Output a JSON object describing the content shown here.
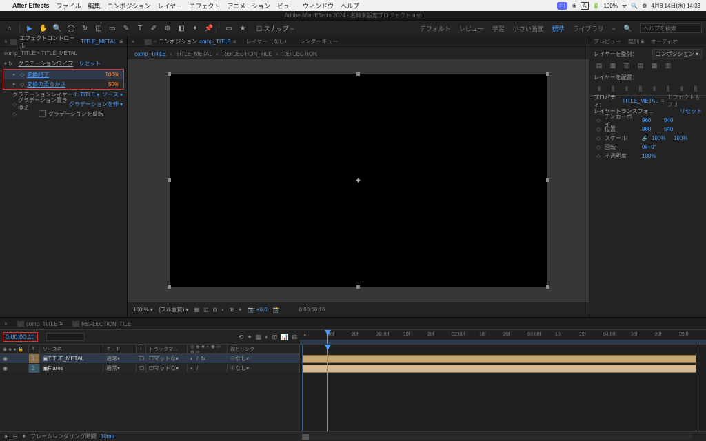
{
  "menubar": {
    "app": "After Effects",
    "items": [
      "ファイル",
      "編集",
      "コンポジション",
      "レイヤー",
      "エフェクト",
      "アニメーション",
      "ビュー",
      "ウィンドウ",
      "ヘルプ"
    ],
    "right": {
      "battery": "100%",
      "time": "4月8 14日(水) 14:33"
    }
  },
  "title": "Adobe After Effects 2024 - 名称未設定プロジェクト.aep",
  "toolbar": {
    "snap": "スナップ",
    "tabs": [
      "デフォルト",
      "レビュー",
      "学習",
      "小さい画面",
      "標準"
    ],
    "library": "ライブラリ",
    "search": "ヘルプを検索"
  },
  "effectsPanel": {
    "tab": "エフェクトコントロール",
    "layer": "TITLE_METAL",
    "compLayer": "comp_TITLE・TITLE_METAL",
    "fxName": "グラデーションワイプ",
    "reset": "リセット",
    "props": {
      "endLabel": "変換終了",
      "endVal": "100%",
      "softLabel": "変換の柔らかさ",
      "softVal": "50%",
      "gradLayer": "グラデーションレイヤー",
      "gradLayerVal": "1. TITLE ▾",
      "source": "ソース ▾",
      "placement": "グラデーション置き換え",
      "placementVal": "グラデーションを伸 ▾",
      "invert": "グラデーションを反転"
    }
  },
  "compPanel": {
    "tab": "コンポジション",
    "comp": "comp_TITLE",
    "other": [
      "レイヤー（なし）",
      "レンダーキュー"
    ],
    "breadcrumb": [
      "comp_TITLE",
      "TITLE_METAL",
      "REFLECTION_TILE",
      "REFLECTION"
    ]
  },
  "viewer": {
    "zoom": "100 %",
    "res": "(フル画質)",
    "exposure": "+0.0",
    "time": "0:00:00:10"
  },
  "rightPanel": {
    "tabs": [
      "プレビュー",
      "整列",
      "オーディオ"
    ],
    "alignTo": "レイヤーを整列：",
    "alignVal": "コンポジション ▾",
    "distribute": "レイヤーを配置：",
    "propHeader": "プロパティ：",
    "propLayer": "TITLE_METAL",
    "fxTab": "エフェクト＆プリ",
    "transform": "レイヤートランスフォ...",
    "reset": "リセット",
    "rows": {
      "anchor": "アンカーポイ…",
      "position": "位置",
      "scale": "スケール",
      "rotation": "回転",
      "opacity": "不透明度",
      "anchorX": "960",
      "anchorY": "540",
      "posX": "960",
      "posY": "540",
      "scaleVal": "100%",
      "scaleVal2": "100%",
      "rotVal": "0x+0°",
      "opVal": "100%"
    }
  },
  "timeline": {
    "tabs": [
      "comp_TITLE",
      "REFLECTION_TILE"
    ],
    "timecode": "0:00:00:10",
    "columns": [
      "",
      "#",
      "ソース名",
      "",
      "モード",
      "",
      "T",
      "トラックマ…",
      "",
      "",
      "親とリンク"
    ],
    "switches": "◎ ◈ ★ ◐  ◉ ☉ ⊕ ✑",
    "layers": [
      {
        "num": "1",
        "name": "TITLE_METAL",
        "mode": "通常",
        "track": "マットな",
        "parent": "なし"
      },
      {
        "num": "2",
        "name": "Flares",
        "mode": "通常",
        "track": "マットな",
        "parent": "なし"
      }
    ],
    "ticks": [
      "10f",
      "20f",
      "01:00f",
      "10f",
      "20f",
      "02:00f",
      "10f",
      "20f",
      "03:00f",
      "10f",
      "20f",
      "04:00f",
      "10f",
      "20f",
      "05:0"
    ],
    "render": "フレームレンダリング時間",
    "renderTime": "10ms"
  }
}
